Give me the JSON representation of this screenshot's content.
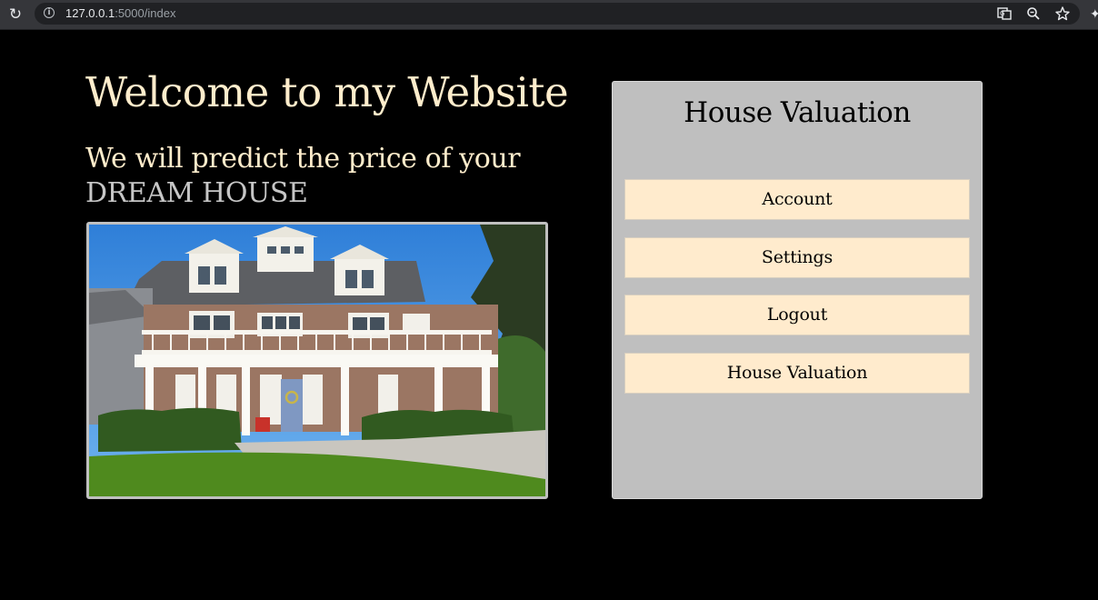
{
  "browser": {
    "url_host": "127.0.0.1",
    "url_path": ":5000/index",
    "icons": [
      "reload-icon",
      "info-icon",
      "translate-icon",
      "zoom-icon",
      "bookmark-star-icon",
      "extensions-icon"
    ]
  },
  "hero": {
    "title": "Welcome to my Website",
    "subtitle_line1": "We will predict the price of your",
    "subtitle_line2": "DREAM HOUSE"
  },
  "panel": {
    "title": "House Valuation",
    "menu": [
      {
        "label": "Account"
      },
      {
        "label": "Settings"
      },
      {
        "label": "Logout"
      },
      {
        "label": "House Valuation"
      }
    ]
  },
  "colors": {
    "page_background": "#000000",
    "heading_text": "#ffedcc",
    "dream_text": "#c6c6c6",
    "panel_background": "#bfbfbf",
    "button_background": "#ffebcd"
  }
}
